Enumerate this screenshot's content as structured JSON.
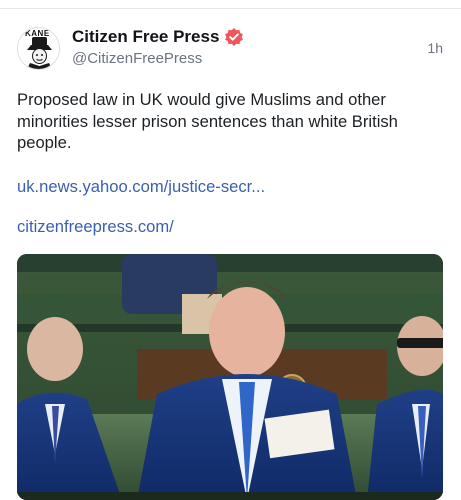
{
  "post": {
    "author": {
      "display_name": "Citizen Free Press",
      "handle": "@CitizenFreePress",
      "avatar_text": "KANE",
      "verified_color": "#f2545b"
    },
    "timestamp": "1h",
    "text": "Proposed law in UK would give Muslims and other minorities lesser prison sentences than white British people.",
    "links": [
      "uk.news.yahoo.com/justice-secr...",
      "citizenfreepress.com/"
    ],
    "media": {
      "type": "video-thumbnail"
    }
  },
  "colors": {
    "link": "#3a5fb0",
    "muted": "#6b7480",
    "verified_badge": "#f2545b"
  }
}
